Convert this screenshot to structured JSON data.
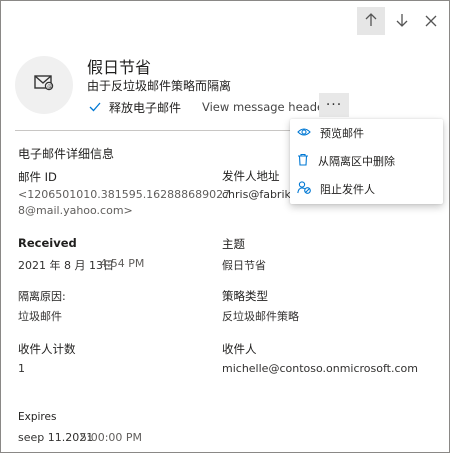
{
  "header": {
    "up_label": "",
    "down_label": "",
    "close_label": ""
  },
  "message": {
    "subject": "假日节省",
    "reason": "由于反垃圾邮件策略而隔离",
    "release_label": "释放电子邮件",
    "view_headers_label": "View message headers",
    "more_label": "···"
  },
  "details": {
    "section_title": "电子邮件详细信息",
    "email_id_label": "邮件 ID",
    "email_id_line1": "<1206501010.381595.162888689027",
    "email_id_line2": "8@mail.yahoo.com>",
    "sender_label": "发件人地址",
    "sender_value": "chris@fabrikam",
    "received_label": "Received",
    "received_value": "2021 年 8 月 13日",
    "received_time": "4:54 PM",
    "subject_label": "主题",
    "subject_value": "假日节省",
    "reason_label": "隔离原因:",
    "reason_value": "垃圾邮件",
    "policy_label": "策略类型",
    "policy_value": "反垃圾邮件策略",
    "recipient_count_label": "收件人计数",
    "recipient_count_value": "1",
    "recipient_label": "收件人",
    "recipient_value": "michelle@contoso.onmicrosoft.com",
    "expires_label": "Expires",
    "expires_date": "seep 11.2021",
    "expires_time": "5:00:00 PM"
  },
  "menu": {
    "items": [
      {
        "label": "预览邮件",
        "icon": "eye-icon"
      },
      {
        "label": "从隔离区中删除",
        "icon": "trash-icon"
      },
      {
        "label": "阻止发件人",
        "icon": "block-person-icon"
      }
    ]
  },
  "colors": {
    "accent": "#0078d4",
    "border": "#8a8886",
    "active_button": "#e6e6e6"
  }
}
